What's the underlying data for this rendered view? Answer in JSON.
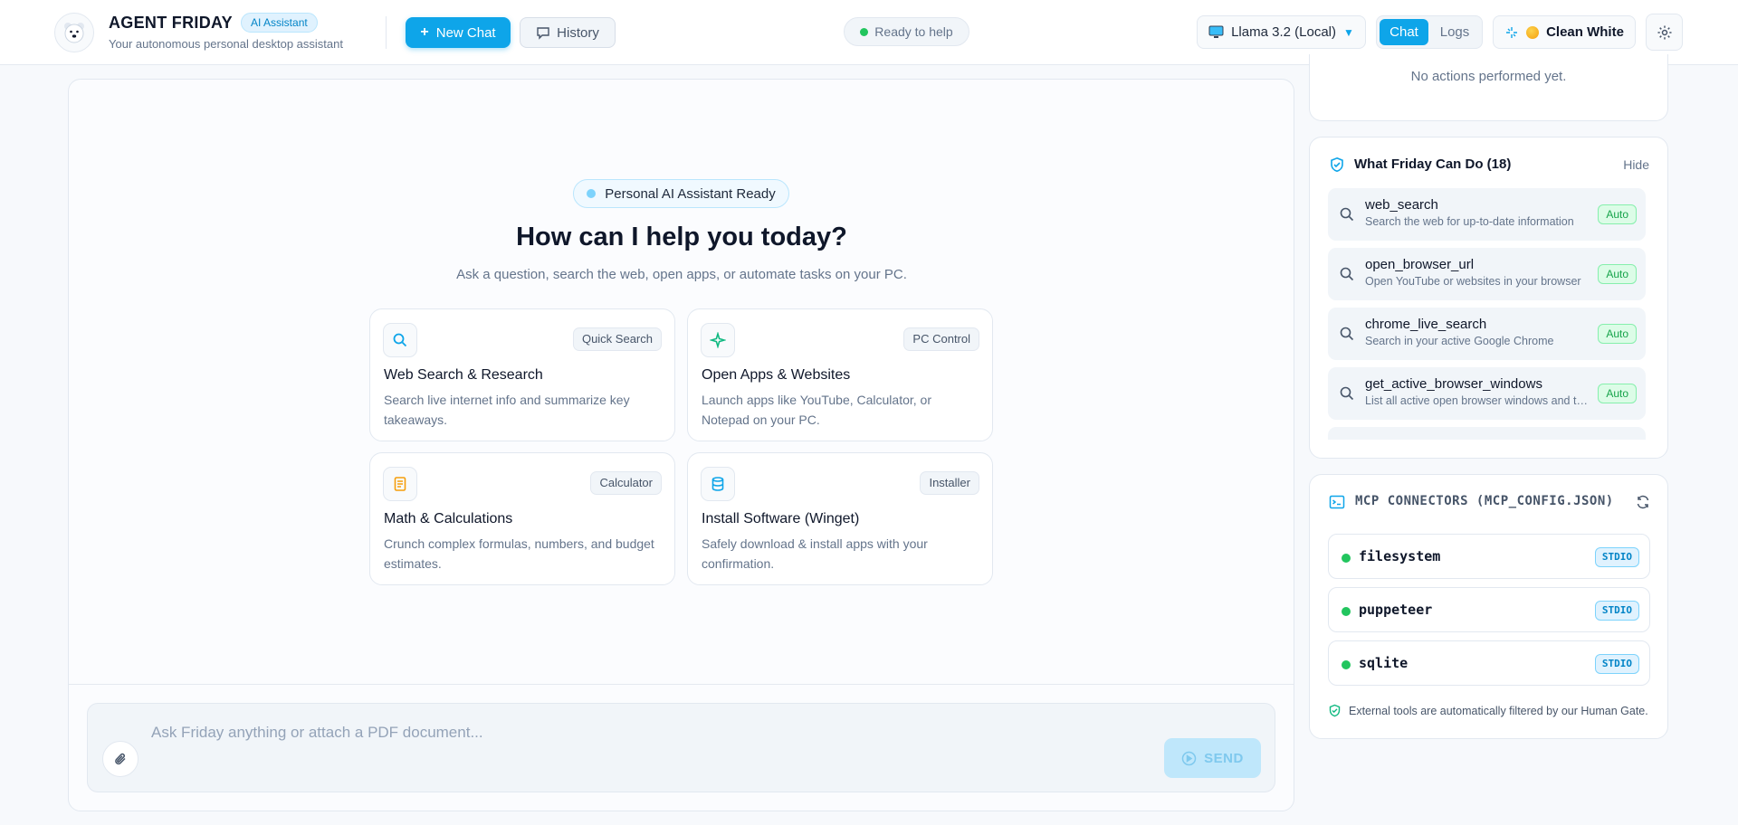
{
  "header": {
    "app_title": "AGENT FRIDAY",
    "badge": "AI Assistant",
    "subtitle": "Your autonomous personal desktop assistant",
    "new_chat": "New Chat",
    "history": "History",
    "status": "Ready to help",
    "model": "Llama 3.2 (Local)",
    "tabs": [
      "Chat",
      "Logs"
    ],
    "active_tab": "Chat",
    "theme": "Clean White"
  },
  "main": {
    "ready_pill": "Personal AI Assistant Ready",
    "title": "How can I help you today?",
    "subtitle": "Ask a question, search the web, open apps, or automate tasks on your PC.",
    "features": [
      {
        "icon": "search-icon",
        "tag": "Quick Search",
        "title": "Web Search & Research",
        "desc": "Search live internet info and summarize key takeaways."
      },
      {
        "icon": "sparkle-icon",
        "tag": "PC Control",
        "title": "Open Apps & Websites",
        "desc": "Launch apps like YouTube, Calculator, or Notepad on your PC."
      },
      {
        "icon": "document-icon",
        "tag": "Calculator",
        "title": "Math & Calculations",
        "desc": "Crunch complex formulas, numbers, and budget estimates."
      },
      {
        "icon": "database-icon",
        "tag": "Installer",
        "title": "Install Software (Winget)",
        "desc": "Safely download & install apps with your confirmation."
      }
    ],
    "composer": {
      "placeholder": "Ask Friday anything or attach a PDF document...",
      "send": "SEND"
    }
  },
  "sidebar": {
    "actions_empty": "No actions performed yet.",
    "capabilities": {
      "title": "What Friday Can Do (18)",
      "hide": "Hide",
      "tools": [
        {
          "name": "web_search",
          "desc": "Search the web for up-to-date information",
          "mode": "Auto"
        },
        {
          "name": "open_browser_url",
          "desc": "Open YouTube or websites in your browser",
          "mode": "Auto"
        },
        {
          "name": "chrome_live_search",
          "desc": "Search in your active Google Chrome",
          "mode": "Auto"
        },
        {
          "name": "get_active_browser_windows",
          "desc": "List all active open browser windows and ta...",
          "mode": "Auto"
        }
      ]
    },
    "mcp": {
      "title": "MCP CONNECTORS (MCP_CONFIG.JSON)",
      "connectors": [
        {
          "name": "filesystem",
          "transport": "STDIO"
        },
        {
          "name": "puppeteer",
          "transport": "STDIO"
        },
        {
          "name": "sqlite",
          "transport": "STDIO"
        }
      ],
      "footer": "External tools are automatically filtered by our Human Gate."
    }
  },
  "colors": {
    "accent": "#0ea5e9",
    "success": "#22c55e",
    "text": "#0f172a",
    "muted": "#64748b"
  }
}
